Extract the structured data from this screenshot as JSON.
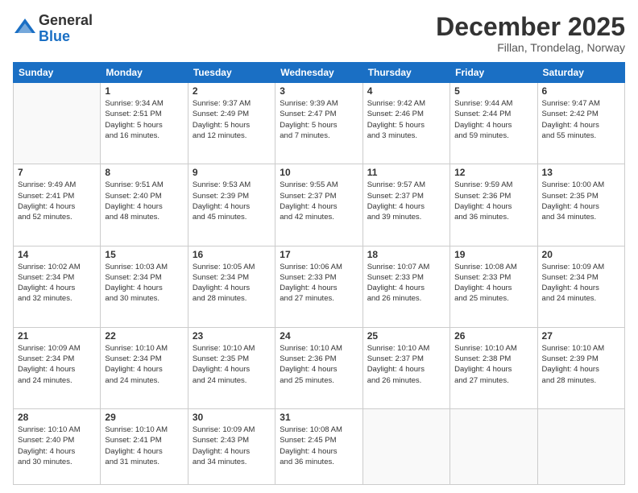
{
  "logo": {
    "general": "General",
    "blue": "Blue"
  },
  "title": "December 2025",
  "location": "Fillan, Trondelag, Norway",
  "days_header": [
    "Sunday",
    "Monday",
    "Tuesday",
    "Wednesday",
    "Thursday",
    "Friday",
    "Saturday"
  ],
  "weeks": [
    [
      {
        "day": "",
        "info": ""
      },
      {
        "day": "1",
        "info": "Sunrise: 9:34 AM\nSunset: 2:51 PM\nDaylight: 5 hours\nand 16 minutes."
      },
      {
        "day": "2",
        "info": "Sunrise: 9:37 AM\nSunset: 2:49 PM\nDaylight: 5 hours\nand 12 minutes."
      },
      {
        "day": "3",
        "info": "Sunrise: 9:39 AM\nSunset: 2:47 PM\nDaylight: 5 hours\nand 7 minutes."
      },
      {
        "day": "4",
        "info": "Sunrise: 9:42 AM\nSunset: 2:46 PM\nDaylight: 5 hours\nand 3 minutes."
      },
      {
        "day": "5",
        "info": "Sunrise: 9:44 AM\nSunset: 2:44 PM\nDaylight: 4 hours\nand 59 minutes."
      },
      {
        "day": "6",
        "info": "Sunrise: 9:47 AM\nSunset: 2:42 PM\nDaylight: 4 hours\nand 55 minutes."
      }
    ],
    [
      {
        "day": "7",
        "info": "Sunrise: 9:49 AM\nSunset: 2:41 PM\nDaylight: 4 hours\nand 52 minutes."
      },
      {
        "day": "8",
        "info": "Sunrise: 9:51 AM\nSunset: 2:40 PM\nDaylight: 4 hours\nand 48 minutes."
      },
      {
        "day": "9",
        "info": "Sunrise: 9:53 AM\nSunset: 2:39 PM\nDaylight: 4 hours\nand 45 minutes."
      },
      {
        "day": "10",
        "info": "Sunrise: 9:55 AM\nSunset: 2:37 PM\nDaylight: 4 hours\nand 42 minutes."
      },
      {
        "day": "11",
        "info": "Sunrise: 9:57 AM\nSunset: 2:37 PM\nDaylight: 4 hours\nand 39 minutes."
      },
      {
        "day": "12",
        "info": "Sunrise: 9:59 AM\nSunset: 2:36 PM\nDaylight: 4 hours\nand 36 minutes."
      },
      {
        "day": "13",
        "info": "Sunrise: 10:00 AM\nSunset: 2:35 PM\nDaylight: 4 hours\nand 34 minutes."
      }
    ],
    [
      {
        "day": "14",
        "info": "Sunrise: 10:02 AM\nSunset: 2:34 PM\nDaylight: 4 hours\nand 32 minutes."
      },
      {
        "day": "15",
        "info": "Sunrise: 10:03 AM\nSunset: 2:34 PM\nDaylight: 4 hours\nand 30 minutes."
      },
      {
        "day": "16",
        "info": "Sunrise: 10:05 AM\nSunset: 2:34 PM\nDaylight: 4 hours\nand 28 minutes."
      },
      {
        "day": "17",
        "info": "Sunrise: 10:06 AM\nSunset: 2:33 PM\nDaylight: 4 hours\nand 27 minutes."
      },
      {
        "day": "18",
        "info": "Sunrise: 10:07 AM\nSunset: 2:33 PM\nDaylight: 4 hours\nand 26 minutes."
      },
      {
        "day": "19",
        "info": "Sunrise: 10:08 AM\nSunset: 2:33 PM\nDaylight: 4 hours\nand 25 minutes."
      },
      {
        "day": "20",
        "info": "Sunrise: 10:09 AM\nSunset: 2:34 PM\nDaylight: 4 hours\nand 24 minutes."
      }
    ],
    [
      {
        "day": "21",
        "info": "Sunrise: 10:09 AM\nSunset: 2:34 PM\nDaylight: 4 hours\nand 24 minutes."
      },
      {
        "day": "22",
        "info": "Sunrise: 10:10 AM\nSunset: 2:34 PM\nDaylight: 4 hours\nand 24 minutes."
      },
      {
        "day": "23",
        "info": "Sunrise: 10:10 AM\nSunset: 2:35 PM\nDaylight: 4 hours\nand 24 minutes."
      },
      {
        "day": "24",
        "info": "Sunrise: 10:10 AM\nSunset: 2:36 PM\nDaylight: 4 hours\nand 25 minutes."
      },
      {
        "day": "25",
        "info": "Sunrise: 10:10 AM\nSunset: 2:37 PM\nDaylight: 4 hours\nand 26 minutes."
      },
      {
        "day": "26",
        "info": "Sunrise: 10:10 AM\nSunset: 2:38 PM\nDaylight: 4 hours\nand 27 minutes."
      },
      {
        "day": "27",
        "info": "Sunrise: 10:10 AM\nSunset: 2:39 PM\nDaylight: 4 hours\nand 28 minutes."
      }
    ],
    [
      {
        "day": "28",
        "info": "Sunrise: 10:10 AM\nSunset: 2:40 PM\nDaylight: 4 hours\nand 30 minutes."
      },
      {
        "day": "29",
        "info": "Sunrise: 10:10 AM\nSunset: 2:41 PM\nDaylight: 4 hours\nand 31 minutes."
      },
      {
        "day": "30",
        "info": "Sunrise: 10:09 AM\nSunset: 2:43 PM\nDaylight: 4 hours\nand 34 minutes."
      },
      {
        "day": "31",
        "info": "Sunrise: 10:08 AM\nSunset: 2:45 PM\nDaylight: 4 hours\nand 36 minutes."
      },
      {
        "day": "",
        "info": ""
      },
      {
        "day": "",
        "info": ""
      },
      {
        "day": "",
        "info": ""
      }
    ]
  ]
}
